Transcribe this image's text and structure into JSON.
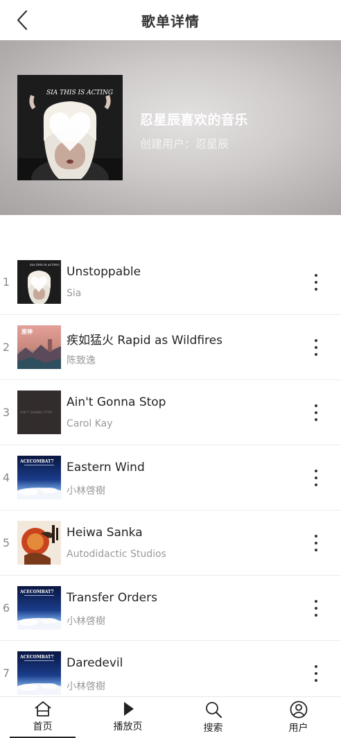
{
  "header": {
    "title": "歌单详情"
  },
  "playlist": {
    "name": "忍星辰喜欢的音乐",
    "creator": "创建用户：忍星辰",
    "cover_title": "SIA THIS IS ACTING"
  },
  "songs": [
    {
      "index": "1",
      "title": "Unstoppable",
      "artist": "Sia",
      "cover_text": "SIA THIS IS ACTING"
    },
    {
      "index": "2",
      "title": "疾如猛火 Rapid as Wildfires",
      "artist": "陈致逸",
      "cover_text": "原神"
    },
    {
      "index": "3",
      "title": "Ain't Gonna Stop",
      "artist": "Carol Kay",
      "cover_text": "AIN'T GONNA STOP"
    },
    {
      "index": "4",
      "title": "Eastern Wind",
      "artist": "小林啓樹",
      "cover_text": "ACECOMBAT7"
    },
    {
      "index": "5",
      "title": "Heiwa Sanka",
      "artist": "Autodidactic Studios",
      "cover_text": ""
    },
    {
      "index": "6",
      "title": "Transfer Orders",
      "artist": "小林啓樹",
      "cover_text": "ACECOMBAT7"
    },
    {
      "index": "7",
      "title": "Daredevil",
      "artist": "小林啓樹",
      "cover_text": "ACECOMBAT7"
    }
  ],
  "tabs": [
    {
      "label": "首页",
      "icon": "home-icon",
      "active": true
    },
    {
      "label": "播放页",
      "icon": "play-icon",
      "active": false
    },
    {
      "label": "搜索",
      "icon": "search-icon",
      "active": false
    },
    {
      "label": "用户",
      "icon": "user-icon",
      "active": false
    }
  ],
  "colors": {
    "accent": "#222222",
    "muted": "#999999",
    "divider": "#ececec"
  }
}
